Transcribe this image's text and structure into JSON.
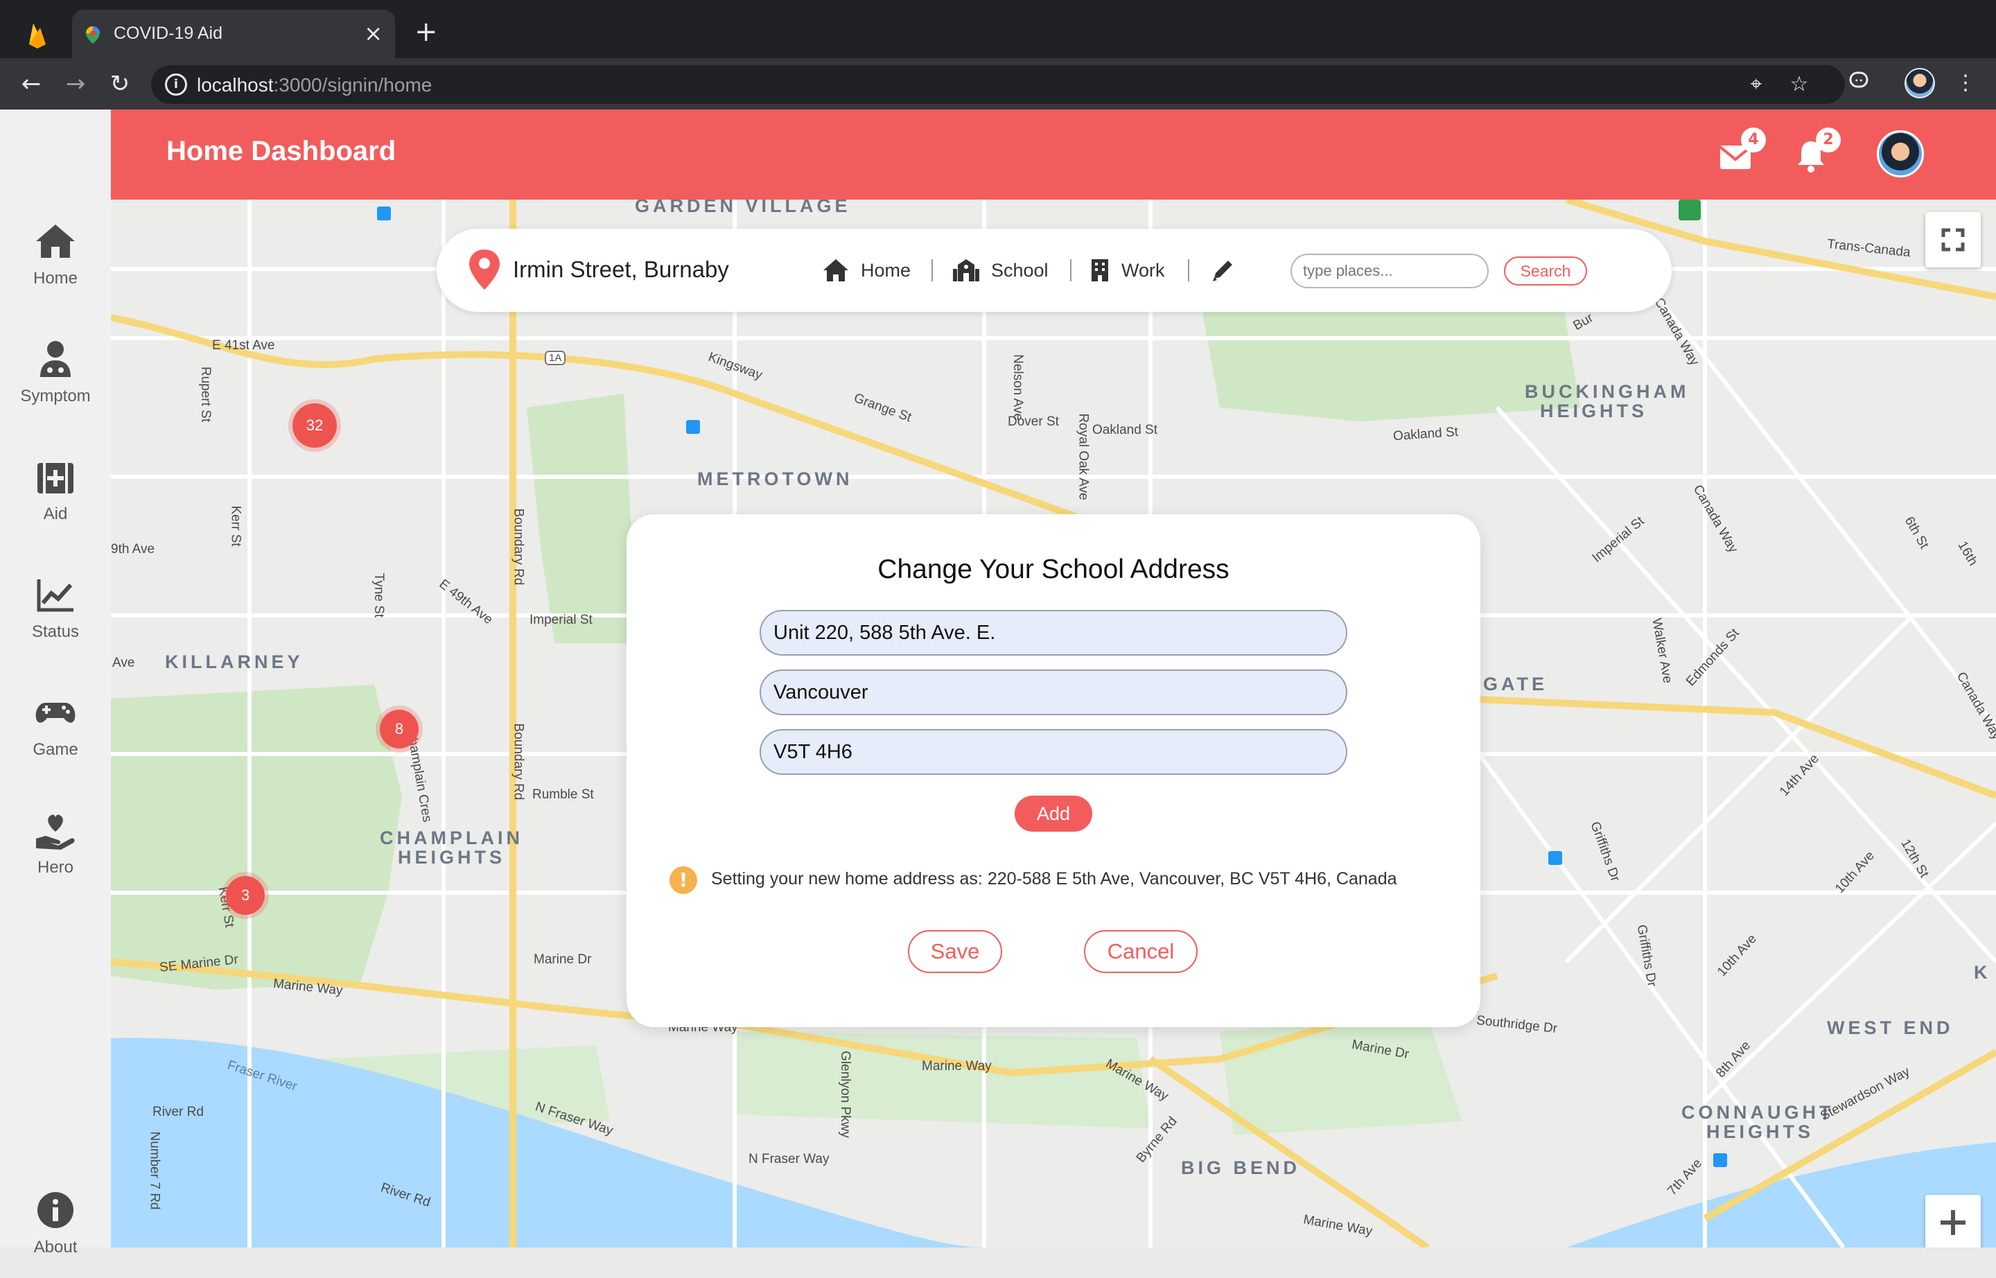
{
  "browser": {
    "tab_title": "COVID-19 Aid",
    "new_tab": "+",
    "close": "×",
    "url_host": "localhost",
    "url_path": ":3000/signin/home"
  },
  "sidebar": {
    "items": [
      {
        "label": "Home",
        "icon": "home-icon"
      },
      {
        "label": "Symptom",
        "icon": "doctor-icon"
      },
      {
        "label": "Aid",
        "icon": "first-aid-icon"
      },
      {
        "label": "Status",
        "icon": "chart-icon"
      },
      {
        "label": "Game",
        "icon": "gamepad-icon"
      },
      {
        "label": "Hero",
        "icon": "heart-hand-icon"
      },
      {
        "label": "About",
        "icon": "info-icon"
      }
    ]
  },
  "header": {
    "title": "Home Dashboard",
    "mail_count": "4",
    "notification_count": "2",
    "brand_color": "#f35c5c"
  },
  "place_bar": {
    "current_place": "Irmin Street, Burnaby",
    "buttons": [
      {
        "label": "Home",
        "icon": "home-icon"
      },
      {
        "label": "School",
        "icon": "school-icon"
      },
      {
        "label": "Work",
        "icon": "building-icon"
      }
    ],
    "search_placeholder": "type places...",
    "search_label": "Search"
  },
  "map": {
    "areas": [
      "GARDEN VILLAGE",
      "BUCKINGHAM",
      "HEIGHTS",
      "METROTOWN",
      "KILLARNEY",
      "CHAMPLAIN",
      "HEIGHTS",
      "GATE",
      "WEST END",
      "CONNAUGHT",
      "HEIGHTS",
      "BIG BEND",
      "K"
    ],
    "streets": [
      "E 41st Ave",
      "Kingsway",
      "Grange St",
      "Nelson Ave",
      "Dover St",
      "Oakland St",
      "Royal Oak Ave",
      "Oakland St",
      "Rupert St",
      "Kerr St",
      "9th Ave",
      "Ave",
      "E 49th Ave",
      "Tyne St",
      "Imperial St",
      "Boundary Rd",
      "Boundary Rd",
      "Rumble St",
      "Champlain Cres",
      "Kerr St",
      "SE Marine Dr",
      "Marine Way",
      "Marine Dr",
      "Marine Way",
      "Marine Way",
      "Marine Way",
      "Marine Dr",
      "Fraser River",
      "River Rd",
      "River Rd",
      "Number 7 Rd",
      "N Fraser Way",
      "N Fraser Way",
      "Glenlyon Pkwy",
      "Byrne Rd",
      "Marine Way",
      "Southridge Dr",
      "Trans-Canada",
      "Canada Way",
      "Imperial St",
      "Canada Way",
      "Walker Ave",
      "Edmonds St",
      "14th Ave",
      "Griffiths Dr",
      "Griffiths Dr",
      "10th Ave",
      "12th St",
      "10th Ave",
      "8th Ave",
      "7th Ave",
      "Stewardson Way",
      "6th St",
      "16th",
      "Canada Way",
      "Bur",
      "1A"
    ],
    "clusters": [
      "32",
      "8",
      "3"
    ]
  },
  "dialog": {
    "title": "Change Your School Address",
    "street_value": "Unit 220, 588 5th Ave. E.",
    "city_value": "Vancouver",
    "postal_value": "V5T 4H6",
    "add_label": "Add",
    "warning_text": "Setting your new home address as: 220-588 E 5th Ave, Vancouver, BC V5T 4H6, Canada",
    "save_label": "Save",
    "cancel_label": "Cancel"
  }
}
